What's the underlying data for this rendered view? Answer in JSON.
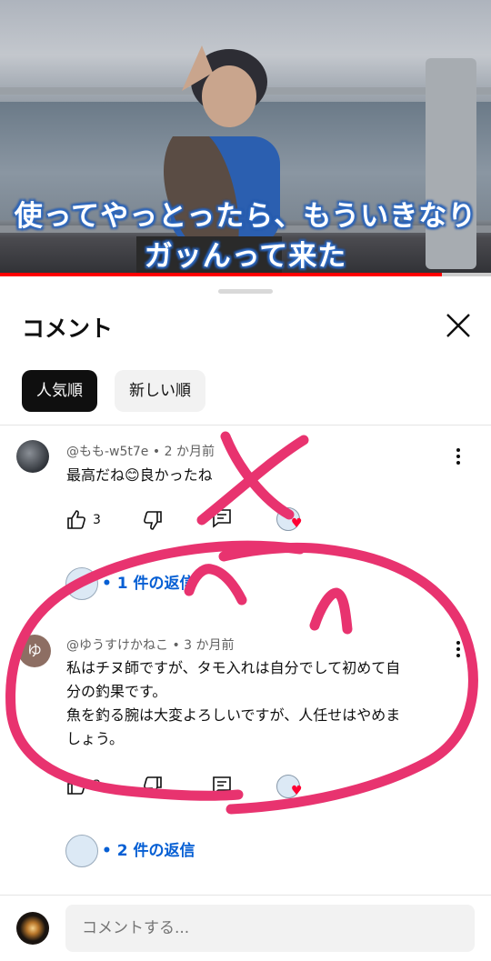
{
  "video": {
    "caption_line1": "使ってやっとったら、もういきなり",
    "caption_line2": "ガッんって来た",
    "progress": 0.9
  },
  "sheet": {
    "title": "コメント",
    "close_icon": "close-icon",
    "chips": [
      {
        "label": "人気順",
        "selected": true
      },
      {
        "label": "新しい順",
        "selected": false
      }
    ]
  },
  "comments": [
    {
      "author": "@もも-w5t7e",
      "time": "2 か月前",
      "text": "最高だね😊良かったね",
      "likes": "3",
      "replies": "1 件の返信",
      "creator_heart": true
    },
    {
      "author": "@ゆうすけかねこ",
      "avatar_letter": "ゆ",
      "time": "3 か月前",
      "text_lines": [
        "私はチヌ師ですが、タモ入れは自分でして初めて自",
        "分の釣果です。",
        "魚を釣る腕は大変よろしいですが、人任せはやめま",
        "しょう。"
      ],
      "likes": "3",
      "replies": "2 件の返信",
      "creator_heart": true
    }
  ],
  "compose": {
    "placeholder": "コメントする..."
  },
  "colors": {
    "accent_link": "#065fd4",
    "annotation_pink": "#e8336f",
    "progress_red": "#ff0000"
  }
}
